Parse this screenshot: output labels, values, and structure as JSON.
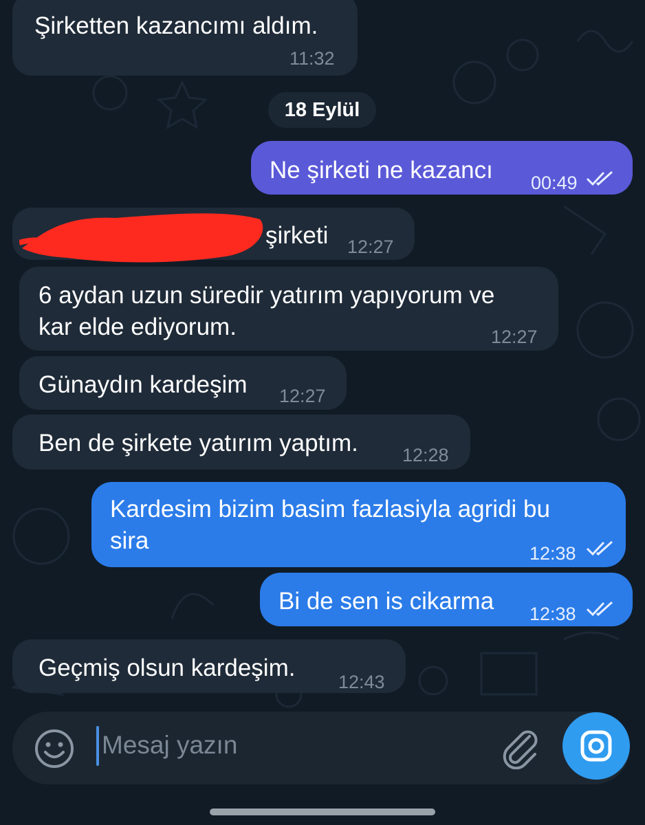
{
  "date_separator": "18 Eylül",
  "messages": [
    {
      "direction": "incoming",
      "text": "Şirketten kazancımı aldım.",
      "time": "11:32"
    },
    {
      "direction": "outgoing",
      "text": "Ne şirketi ne kazancı",
      "time": "00:49",
      "status": "read"
    },
    {
      "direction": "incoming",
      "text": "şirketi",
      "time": "12:27",
      "redacted": true
    },
    {
      "direction": "incoming",
      "text_line1": "6 aydan uzun süredir yatırım yapıyorum ve",
      "text_line2": "kar elde ediyorum.",
      "time": "12:27"
    },
    {
      "direction": "incoming",
      "text": "Günaydın kardeşim",
      "time": "12:27"
    },
    {
      "direction": "incoming",
      "text": "Ben de şirkete yatırım yaptım.",
      "time": "12:28"
    },
    {
      "direction": "outgoing",
      "text_line1": "Kardesim bizim basim fazlasiyla agridi bu",
      "text_line2": "sira",
      "time": "12:38",
      "status": "read"
    },
    {
      "direction": "outgoing",
      "text": "Bi de sen is cikarma",
      "time": "12:38",
      "status": "read"
    },
    {
      "direction": "incoming",
      "text": "Geçmiş olsun kardeşim.",
      "time": "12:43"
    }
  ],
  "composer": {
    "placeholder": "Mesaj yazın",
    "emoji_icon": "smiley-icon",
    "attach_icon": "paperclip-icon",
    "camera_icon": "camera-icon"
  },
  "colors": {
    "background": "#111b26",
    "incoming_bubble": "#1f2b38",
    "outgoing_bubble_purple": "#5a59d8",
    "outgoing_bubble_blue": "#2b7ce9",
    "camera_button": "#2f9cf0"
  }
}
